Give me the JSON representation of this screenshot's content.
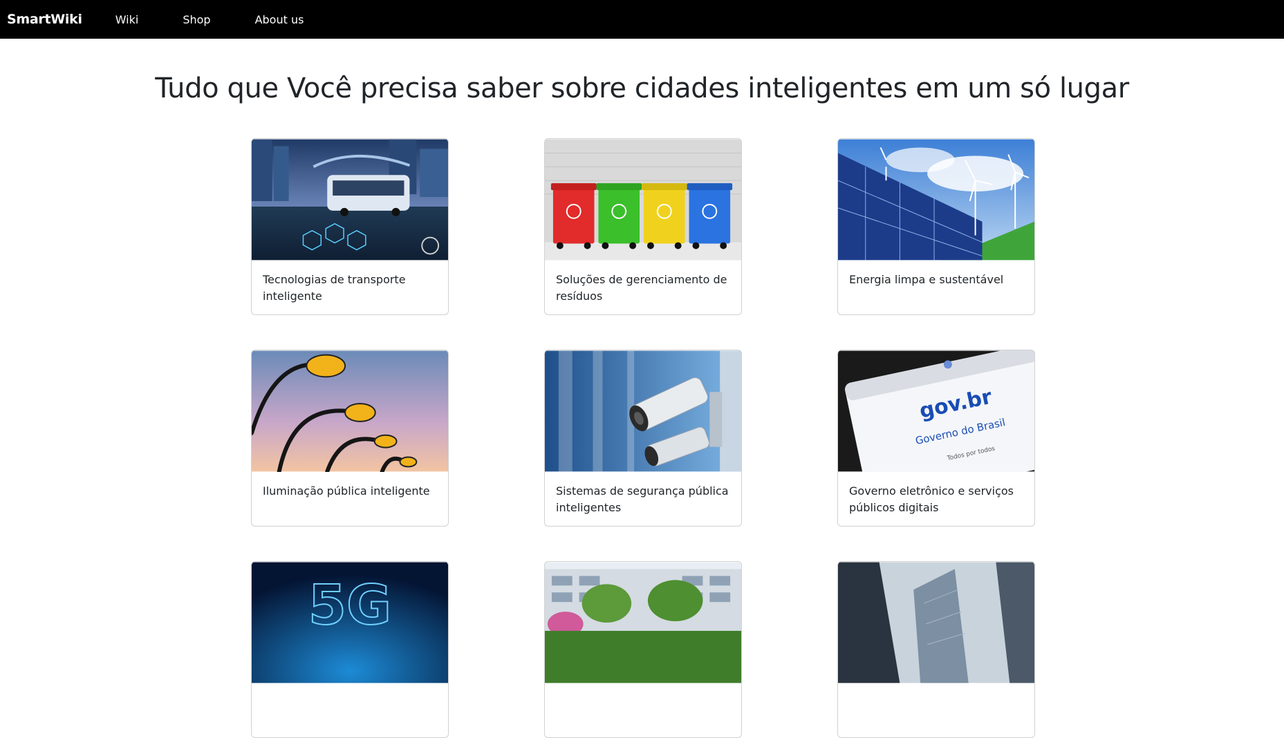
{
  "nav": {
    "brand": "SmartWiki",
    "links": [
      "Wiki",
      "Shop",
      "About us"
    ]
  },
  "page": {
    "title": "Tudo que Você precisa saber sobre cidades inteligentes em um só lugar"
  },
  "cards": [
    {
      "title": "Tecnologias de transporte inteligente",
      "image": "smart-transport-image"
    },
    {
      "title": "Soluções de gerenciamento de resíduos",
      "image": "recycling-bins-image"
    },
    {
      "title": "Energia limpa e sustentável",
      "image": "solar-wind-image"
    },
    {
      "title": "Iluminação pública inteligente",
      "image": "street-lamps-image"
    },
    {
      "title": "Sistemas de segurança pública inteligentes",
      "image": "security-camera-image"
    },
    {
      "title": "Governo eletrônico e serviços públicos digitais",
      "image": "govbr-screen-image"
    },
    {
      "title": "",
      "image": "5g-network-image"
    },
    {
      "title": "",
      "image": "green-building-image"
    },
    {
      "title": "",
      "image": "skyscrapers-image"
    }
  ],
  "images": {
    "govbr_logo": "gov.br",
    "govbr_caption": "Governo do Brasil",
    "govbr_tagline": "Todos por todos",
    "fiveg_label": "5G"
  }
}
